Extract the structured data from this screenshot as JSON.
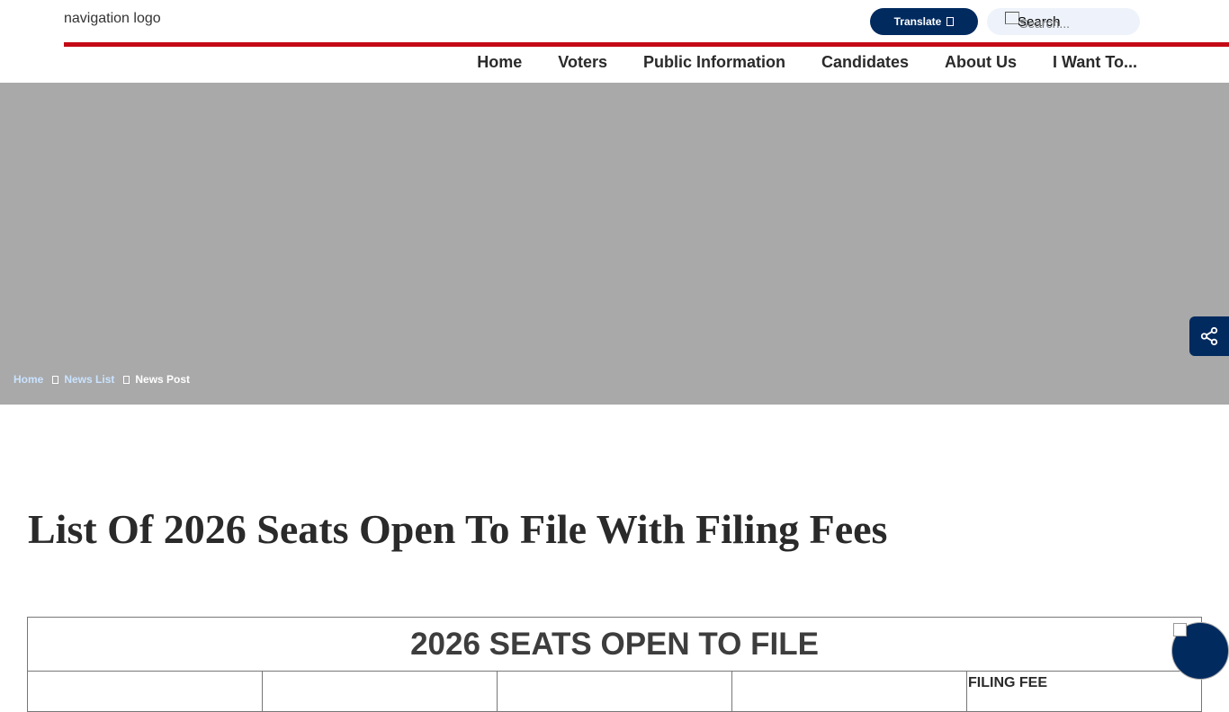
{
  "header": {
    "logo_alt": "navigation logo",
    "translate_label": "Translate",
    "search_alt": "Search",
    "search_placeholder": "Search..."
  },
  "nav": {
    "items": [
      {
        "label": "Home"
      },
      {
        "label": "Voters"
      },
      {
        "label": "Public Information"
      },
      {
        "label": "Candidates"
      },
      {
        "label": "About Us"
      },
      {
        "label": "I Want To..."
      }
    ]
  },
  "breadcrumb": {
    "items": [
      {
        "label": "Home"
      },
      {
        "label": "News List"
      },
      {
        "label": "News Post"
      }
    ]
  },
  "page": {
    "title": "List Of 2026 Seats Open To File With Filing Fees"
  },
  "table": {
    "title": "2026 SEATS OPEN TO FILE",
    "headers": [
      "",
      "",
      "",
      "",
      "FILING FEE"
    ]
  },
  "colors": {
    "brand_navy": "#012a5f",
    "accent_red": "#c40a16",
    "hero_gray": "#a9a9a9"
  },
  "icons": {
    "share": "share-icon",
    "translate_caret": "caret-icon",
    "breadcrumb_separator": "chevron-right-icon"
  }
}
